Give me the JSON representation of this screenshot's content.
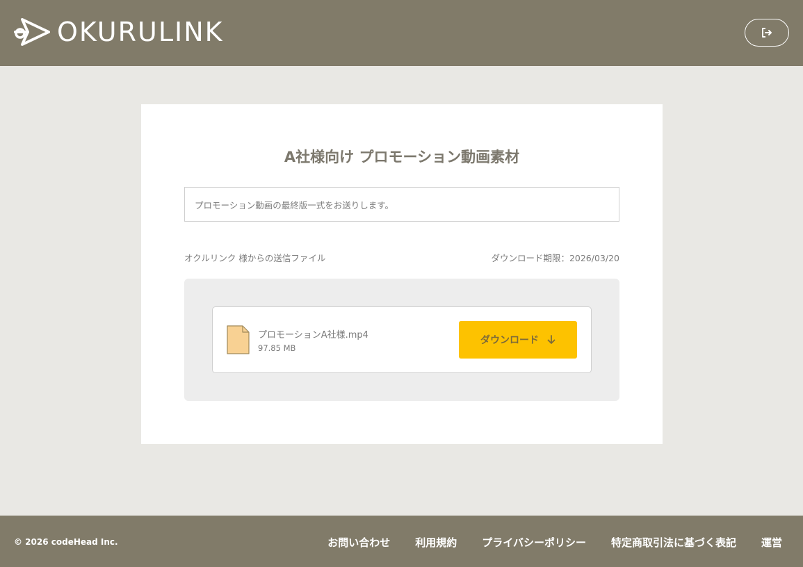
{
  "header": {
    "logo_text": "OKURULINK",
    "logo_icon": "okurulink-logo-mark",
    "logout_icon": "sign-out-icon"
  },
  "transfer": {
    "title": "A社様向け プロモーション動画素材",
    "message": "プロモーション動画の最終版一式をお送りします。",
    "sender": "オクルリンク 様からの送信ファイル",
    "deadline": "ダウンロード期限：2026/03/20",
    "file": {
      "icon": "file-icon",
      "name": "プロモーションA社様.mp4",
      "size": "97.85 MB"
    },
    "download_label": "ダウンロード",
    "download_icon": "arrow-down-icon"
  },
  "footer": {
    "copyright": "© 2026 codeHead Inc.",
    "links": [
      "お問い合わせ",
      "利用規約",
      "プライバシーポリシー",
      "特定商取引法に基づく表記",
      "運営"
    ]
  },
  "colors": {
    "header_bg": "#817b69",
    "page_bg": "#e9e8e4",
    "accent": "#fdc200",
    "file_icon_fill": "#f8d193"
  }
}
